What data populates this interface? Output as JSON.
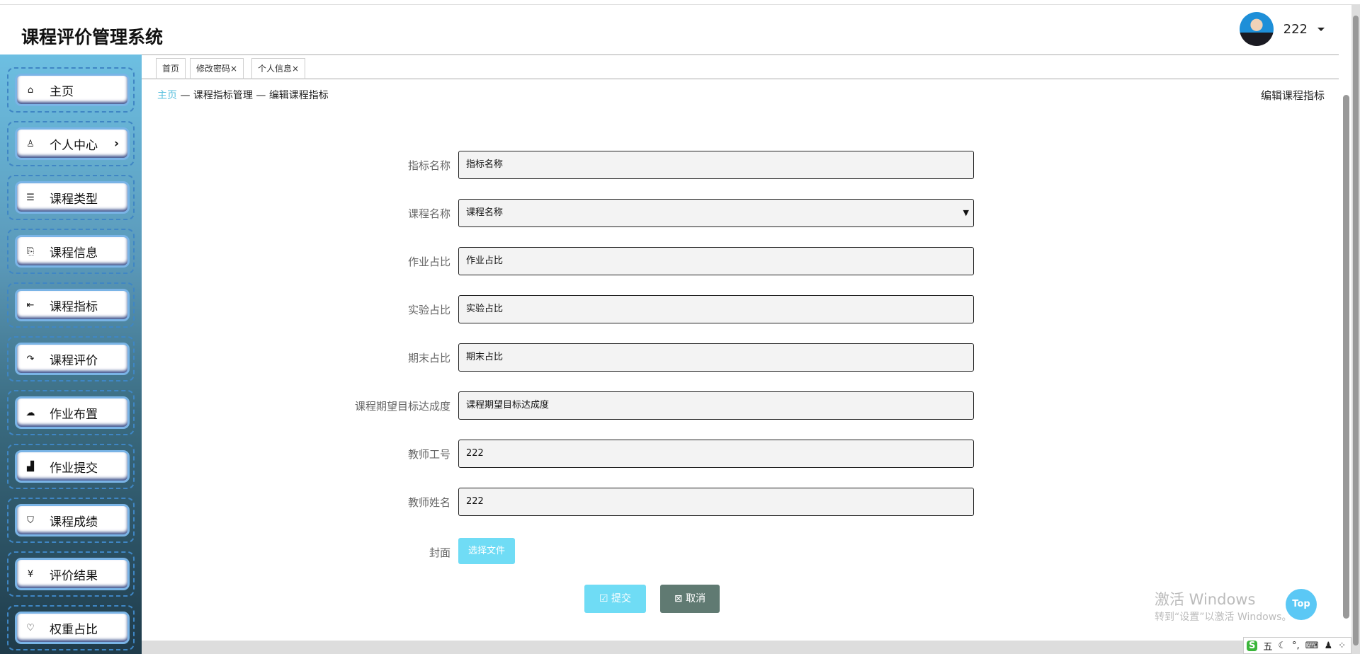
{
  "header": {
    "title": "课程评价管理系统",
    "username": "222"
  },
  "sidebar": {
    "items": [
      {
        "label": "主页",
        "icon": "home-icon",
        "glyph": "⌂"
      },
      {
        "label": "个人中心",
        "icon": "user-icon",
        "glyph": "♙",
        "chevron": "›"
      },
      {
        "label": "课程类型",
        "icon": "list-icon",
        "glyph": "☰"
      },
      {
        "label": "课程信息",
        "icon": "document-icon",
        "glyph": "⎘"
      },
      {
        "label": "课程指标",
        "icon": "login-icon",
        "glyph": "⇤"
      },
      {
        "label": "课程评价",
        "icon": "share-icon",
        "glyph": "↷"
      },
      {
        "label": "作业布置",
        "icon": "cloud-upload-icon",
        "glyph": "☁"
      },
      {
        "label": "作业提交",
        "icon": "bar-chart-icon",
        "glyph": "▟"
      },
      {
        "label": "课程成绩",
        "icon": "shield-icon",
        "glyph": "⛉"
      },
      {
        "label": "评价结果",
        "icon": "yen-icon",
        "glyph": "¥"
      },
      {
        "label": "权重占比",
        "icon": "heart-icon",
        "glyph": "♡"
      }
    ]
  },
  "tabs": [
    {
      "label": "首页"
    },
    {
      "label": "修改密码×"
    },
    {
      "label": "个人信息×"
    }
  ],
  "breadcrumb": {
    "home": "主页",
    "sep": " — ",
    "level1": "课程指标管理",
    "level2": "编辑课程指标"
  },
  "page_title": "编辑课程指标",
  "form": {
    "fields": [
      {
        "label": "指标名称",
        "value": "指标名称"
      },
      {
        "label": "课程名称",
        "value": "课程名称",
        "type": "select"
      },
      {
        "label": "作业占比",
        "value": "作业占比"
      },
      {
        "label": "实验占比",
        "value": "实验占比"
      },
      {
        "label": "期末占比",
        "value": "期末占比"
      },
      {
        "label": "课程期望目标达成度",
        "value": "课程期望目标达成度"
      },
      {
        "label": "教师工号",
        "value": "222"
      },
      {
        "label": "教师姓名",
        "value": "222"
      }
    ],
    "cover_label": "封面",
    "file_button": "选择文件",
    "submit": "提交",
    "cancel": "取消"
  },
  "top_button": "Top",
  "watermark": {
    "line1": "激活 Windows",
    "line2": "转到“设置”以激活 Windows。"
  },
  "ime": {
    "logo": "S",
    "mode": "五"
  },
  "colors": {
    "accent": "#6fdcf5",
    "cancel": "#607a72",
    "breadcrumb_home": "#5bc0de"
  }
}
